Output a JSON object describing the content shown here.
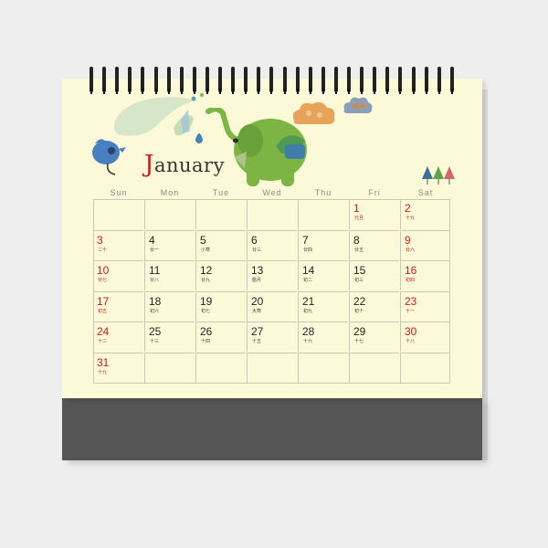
{
  "month_title": {
    "cap": "J",
    "rest": "anuary"
  },
  "weekdays": [
    "Sun",
    "Mon",
    "Tue",
    "Wed",
    "Thu",
    "Fri",
    "Sat"
  ],
  "weeks": [
    [
      null,
      null,
      null,
      null,
      null,
      {
        "day": "1",
        "lunar": "元旦"
      },
      {
        "day": "2",
        "lunar": "十九"
      }
    ],
    [
      {
        "day": "3",
        "lunar": "二十"
      },
      {
        "day": "4",
        "lunar": "廿一"
      },
      {
        "day": "5",
        "lunar": "小寒"
      },
      {
        "day": "6",
        "lunar": "廿三"
      },
      {
        "day": "7",
        "lunar": "廿四"
      },
      {
        "day": "8",
        "lunar": "廿五"
      },
      {
        "day": "9",
        "lunar": "廿六"
      }
    ],
    [
      {
        "day": "10",
        "lunar": "廿七"
      },
      {
        "day": "11",
        "lunar": "廿八"
      },
      {
        "day": "12",
        "lunar": "廿九"
      },
      {
        "day": "13",
        "lunar": "腊月"
      },
      {
        "day": "14",
        "lunar": "初二"
      },
      {
        "day": "15",
        "lunar": "初三"
      },
      {
        "day": "16",
        "lunar": "初四"
      }
    ],
    [
      {
        "day": "17",
        "lunar": "初五"
      },
      {
        "day": "18",
        "lunar": "初六"
      },
      {
        "day": "19",
        "lunar": "初七"
      },
      {
        "day": "20",
        "lunar": "大寒"
      },
      {
        "day": "21",
        "lunar": "初九"
      },
      {
        "day": "22",
        "lunar": "初十"
      },
      {
        "day": "23",
        "lunar": "十一"
      }
    ],
    [
      {
        "day": "24",
        "lunar": "十二"
      },
      {
        "day": "25",
        "lunar": "十三"
      },
      {
        "day": "26",
        "lunar": "十四"
      },
      {
        "day": "27",
        "lunar": "十五"
      },
      {
        "day": "28",
        "lunar": "十六"
      },
      {
        "day": "29",
        "lunar": "十七"
      },
      {
        "day": "30",
        "lunar": "十八"
      }
    ],
    [
      {
        "day": "31",
        "lunar": "十九"
      },
      null,
      null,
      null,
      null,
      null,
      null
    ]
  ],
  "colors": {
    "page": "#fcf9d8",
    "stand": "#555555",
    "holiday": "#d0181e",
    "elephant": "#7db545"
  },
  "icons": [
    "elephant-illustration",
    "blue-bird-illustration",
    "cloud-icon",
    "tree-icon",
    "water-splash-icon"
  ]
}
